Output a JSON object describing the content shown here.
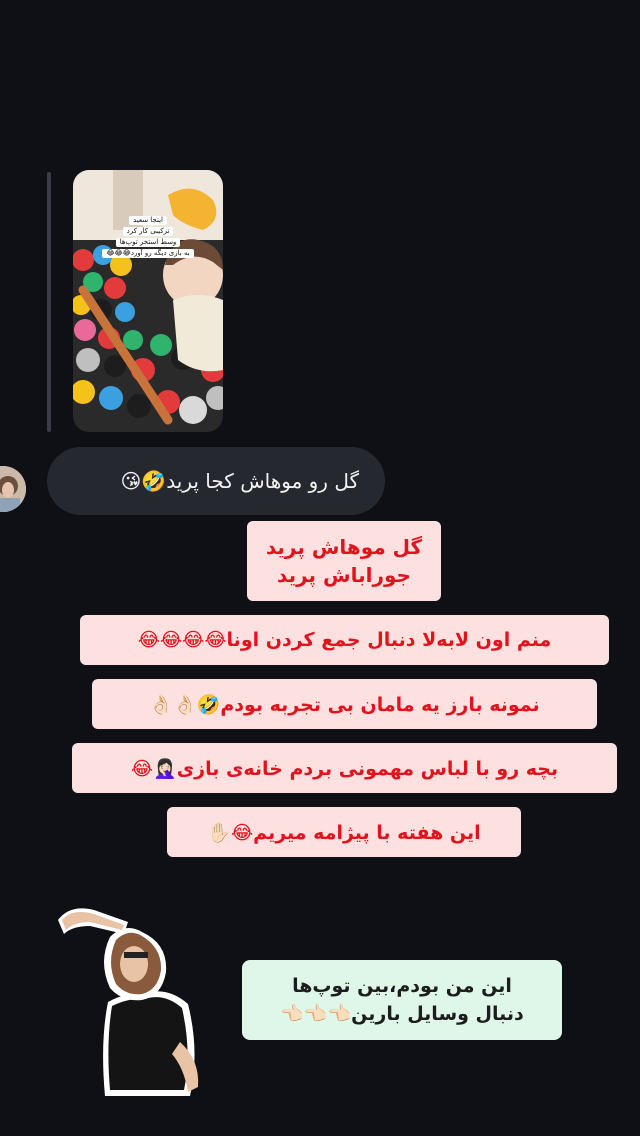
{
  "shared_media": {
    "caption_lines": [
      "اینجا سعید",
      "ترکیبی کار کرد",
      "وسط استخر توپ‌ها",
      "به بازی دیگه رو آورد😂😂😂"
    ],
    "colors": {
      "frame": "#f2ede4",
      "toy": "#f4b431"
    }
  },
  "incoming_message": {
    "text": "گل رو موهاش کجا پرید🤣😘"
  },
  "stickers": [
    {
      "lines": [
        "گل موهاش پرید",
        "جوراباش پرید"
      ]
    },
    {
      "lines": [
        "منم اون لابه‌لا دنبال جمع کردن اونا😂😂😂😂"
      ]
    },
    {
      "lines": [
        "نمونه بارز یه مامان بی تجربه بودم🤣👌🏻👌🏻"
      ]
    },
    {
      "lines": [
        "بچه رو با لباس مهمونی بردم خانه‌ی بازی🤦🏻‍♀️😂"
      ]
    },
    {
      "lines": [
        "این هفته با پیژامه میریم😂✋🏻"
      ]
    },
    {
      "lines": [
        "این من بودم،بین توپ‌ها",
        "دنبال وسایل بارین👈🏻👈🏻👈🏻"
      ]
    }
  ],
  "colors": {
    "background": "#0e1016",
    "incoming_bubble": "#262830",
    "sticker_pink": "#fde0e0",
    "sticker_red_text": "#e2131d",
    "sticker_green": "#dff7e9"
  }
}
